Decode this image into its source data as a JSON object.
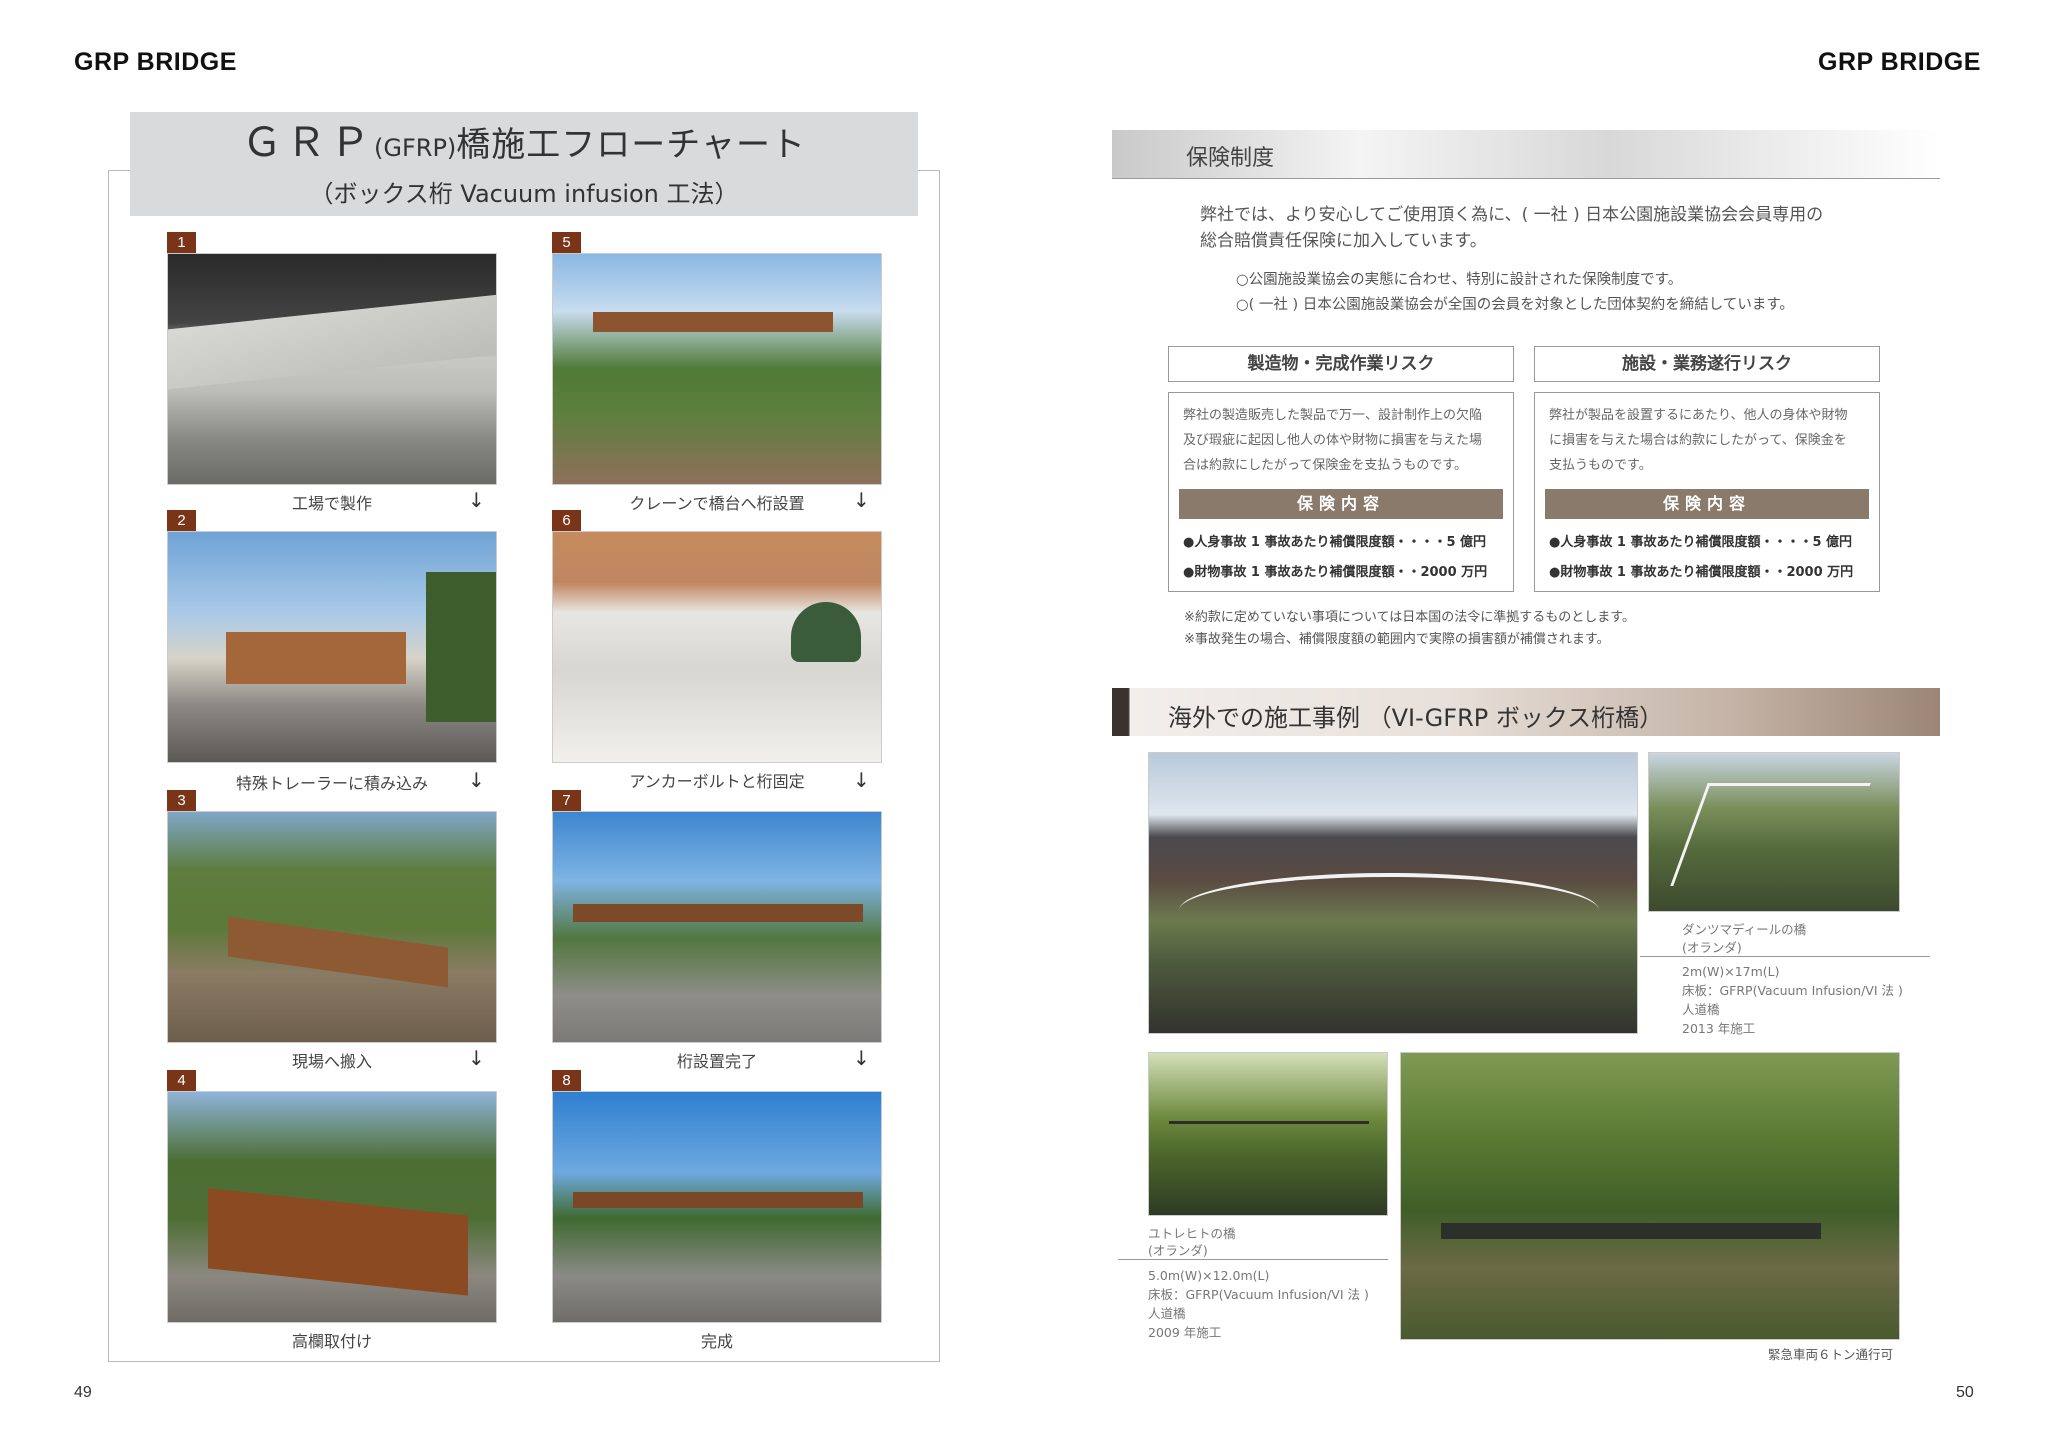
{
  "header_left": "GRP BRIDGE",
  "header_right": "GRP BRIDGE",
  "page_left": "49",
  "page_right": "50",
  "flow": {
    "title_main": "ＧＲＰ",
    "title_paren": "(GFRP)",
    "title_rest": "橋施工フローチャート",
    "subtitle": "（ボックス桁 Vacuum infusion 工法）",
    "steps": [
      {
        "num": "1",
        "caption": "工場で製作"
      },
      {
        "num": "2",
        "caption": "特殊トレーラーに積み込み"
      },
      {
        "num": "3",
        "caption": "現場へ搬入"
      },
      {
        "num": "4",
        "caption": "高欄取付け"
      },
      {
        "num": "5",
        "caption": "クレーンで橋台へ桁設置"
      },
      {
        "num": "6",
        "caption": "アンカーボルトと桁固定"
      },
      {
        "num": "7",
        "caption": "桁設置完了"
      },
      {
        "num": "8",
        "caption": "完成"
      }
    ],
    "arrow": "↓"
  },
  "insurance": {
    "heading": "保険制度",
    "intro1": "弊社では、より安心してご使用頂く為に、( 一社 ) 日本公園施設業協会会員専用の",
    "intro2": "総合賠償責任保険に加入しています。",
    "point1": "○公園施設業協会の実態に合わせ、特別に設計された保険制度です。",
    "point2": "○( 一社 ) 日本公園施設業協会が全国の会員を対象とした団体契約を締結しています。",
    "risks": [
      {
        "title": "製造物・完成作業リスク",
        "text1": "弊社の製造販売した製品で万一、設計制作上の欠陥",
        "text2": "及び瑕疵に起因し他人の体や財物に損害を与えた場",
        "text3": "合は約款にしたがって保険金を支払うものです。",
        "content_label": "保険内容",
        "bullet1": "●人身事故 1 事故あたり補償限度額・・・・5 億円",
        "bullet2": "●財物事故 1 事故あたり補償限度額・・2000 万円"
      },
      {
        "title": "施設・業務遂行リスク",
        "text1": "弊社が製品を設置するにあたり、他人の身体や財物",
        "text2": "に損害を与えた場合は約款にしたがって、保険金を",
        "text3": "支払うものです。",
        "content_label": "保険内容",
        "bullet1": "●人身事故 1 事故あたり補償限度額・・・・5 億円",
        "bullet2": "●財物事故 1 事故あたり補償限度額・・2000 万円"
      }
    ],
    "note1": "※約款に定めていない事項については日本国の法令に準拠するものとします。",
    "note2": "※事故発生の場合、補償限度額の範囲内で実際の損害額が補償されます。"
  },
  "overseas": {
    "heading": "海外での施工事例 （VI-GFRP ボックス桁橋）",
    "case1": {
      "name1": "ダンツマディールの橋",
      "name2": "(オランダ)",
      "size": "2m(W)×17m(L)",
      "deck": "床板：GFRP(Vacuum Infusion/VI 法 )",
      "type": "人道橋",
      "year": "2013 年施工"
    },
    "case2": {
      "name1": "ユトレヒトの橋",
      "name2": "(オランダ)",
      "size": "5.0m(W)×12.0m(L)",
      "deck": "床板：GFRP(Vacuum Infusion/VI 法 )",
      "type": "人道橋",
      "year": "2009 年施工"
    },
    "note": "緊急車両６トン通行可"
  },
  "colors": {
    "badge": "#7a3418",
    "content_bar": "#8a7a6c",
    "overseas_bar_start": "#3a302c",
    "overseas_bar_end": "#a08c7c"
  }
}
